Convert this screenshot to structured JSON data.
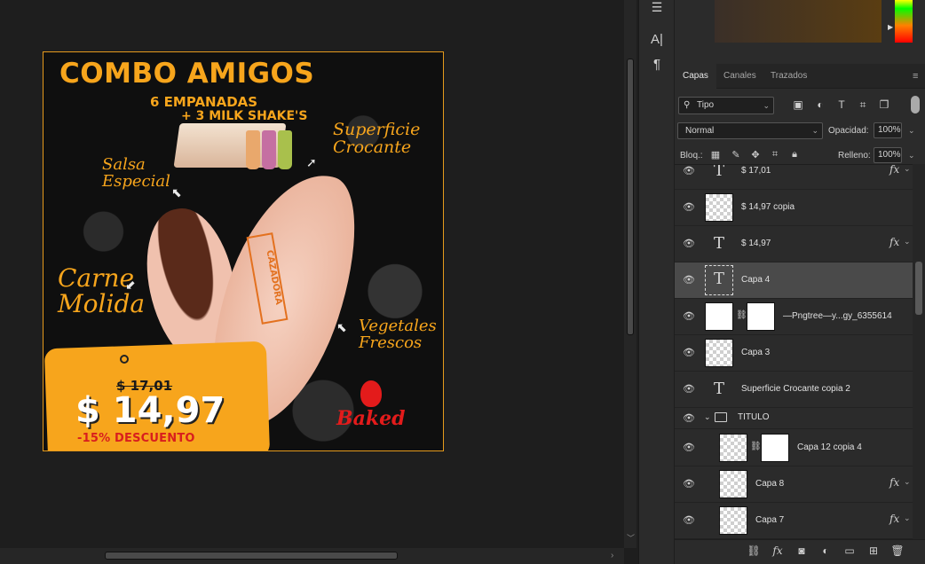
{
  "artwork": {
    "title": "COMBO AMIGOS",
    "subtitle_1": "6 EMPANADAS",
    "subtitle_2": "+ 3 MILK SHAKE'S",
    "label_superficie": "Superficie Crocante",
    "label_salsa": "Salsa Especial",
    "label_carne": "Carne Molida",
    "label_vegetales": "Vegetales Frescos",
    "stamp_text": "CAZADORA",
    "old_price": "$ 17,01",
    "new_price": "$ 14,97",
    "discount": "-15% DESCUENTO",
    "logo_word": "Baked",
    "accent_color": "#f7a51c",
    "logo_color": "#e31b1b"
  },
  "toolstrip": {
    "tool1_icon": "character-icon",
    "tool2_icon": "paragraph-icon",
    "tool1_glyph": "A|",
    "tool2_glyph": "¶"
  },
  "panel": {
    "tabs": [
      {
        "label": "Capas"
      },
      {
        "label": "Canales"
      },
      {
        "label": "Trazados"
      }
    ],
    "filter_value": "Tipo",
    "blend_mode": "Normal",
    "opacity_label": "Opacidad:",
    "opacity_value": "100%",
    "lock_label": "Bloq.:",
    "fill_label": "Relleno:",
    "fill_value": "100%"
  },
  "layers": [
    {
      "name": "$ 17,01",
      "kind": "text",
      "fx": true
    },
    {
      "name": "$ 14,97 copia",
      "kind": "raster",
      "fx": false
    },
    {
      "name": "$ 14,97",
      "kind": "text",
      "fx": true
    },
    {
      "name": "Capa 4",
      "kind": "text-warning",
      "fx": false,
      "selected": true
    },
    {
      "name": "—Pngtree—y...gy_6355614",
      "kind": "smart-mask",
      "fx": false
    },
    {
      "name": "Capa 3",
      "kind": "raster",
      "fx": false
    },
    {
      "name": "Superficie Crocante copia 2",
      "kind": "text",
      "fx": false
    },
    {
      "name": "TITULO",
      "kind": "group",
      "fx": false
    },
    {
      "name": "Capa 12 copia 4",
      "kind": "raster-mask",
      "fx": false
    },
    {
      "name": "Capa 8",
      "kind": "raster",
      "fx": true
    },
    {
      "name": "Capa 7",
      "kind": "raster",
      "fx": true
    }
  ],
  "glyphs": {
    "text_layer": "T",
    "fx": "fx"
  }
}
